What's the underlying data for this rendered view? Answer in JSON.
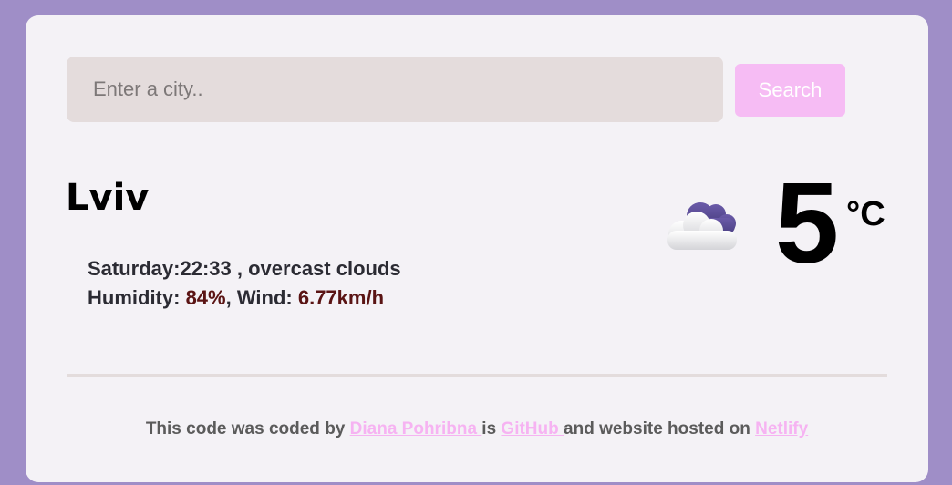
{
  "search": {
    "placeholder": "Enter a city..",
    "value": "",
    "button_label": "Search"
  },
  "weather": {
    "city": "Lviv",
    "day": "Saturday",
    "time": "22:33",
    "description": "overcast clouds",
    "humidity_label": "Humidity: ",
    "humidity_value": "84%",
    "wind_label": "Wind: ",
    "wind_value": "6.77km/h",
    "temperature": "5",
    "unit": "°C",
    "icon": "cloud-icon"
  },
  "footer": {
    "text_1": "This code was coded by ",
    "author_link": "Diana Pohribna ",
    "text_2": " is ",
    "github_link": "GitHub ",
    "text_3": "and website hosted on ",
    "netlify_link": "Netlify"
  },
  "colors": {
    "background": "#9f8ec7",
    "card": "#f4f2f6",
    "input_bg": "#e4dcdc",
    "button_bg": "#f6bcf4",
    "link": "#f6b3f2",
    "accent_values": "#5a1414"
  }
}
